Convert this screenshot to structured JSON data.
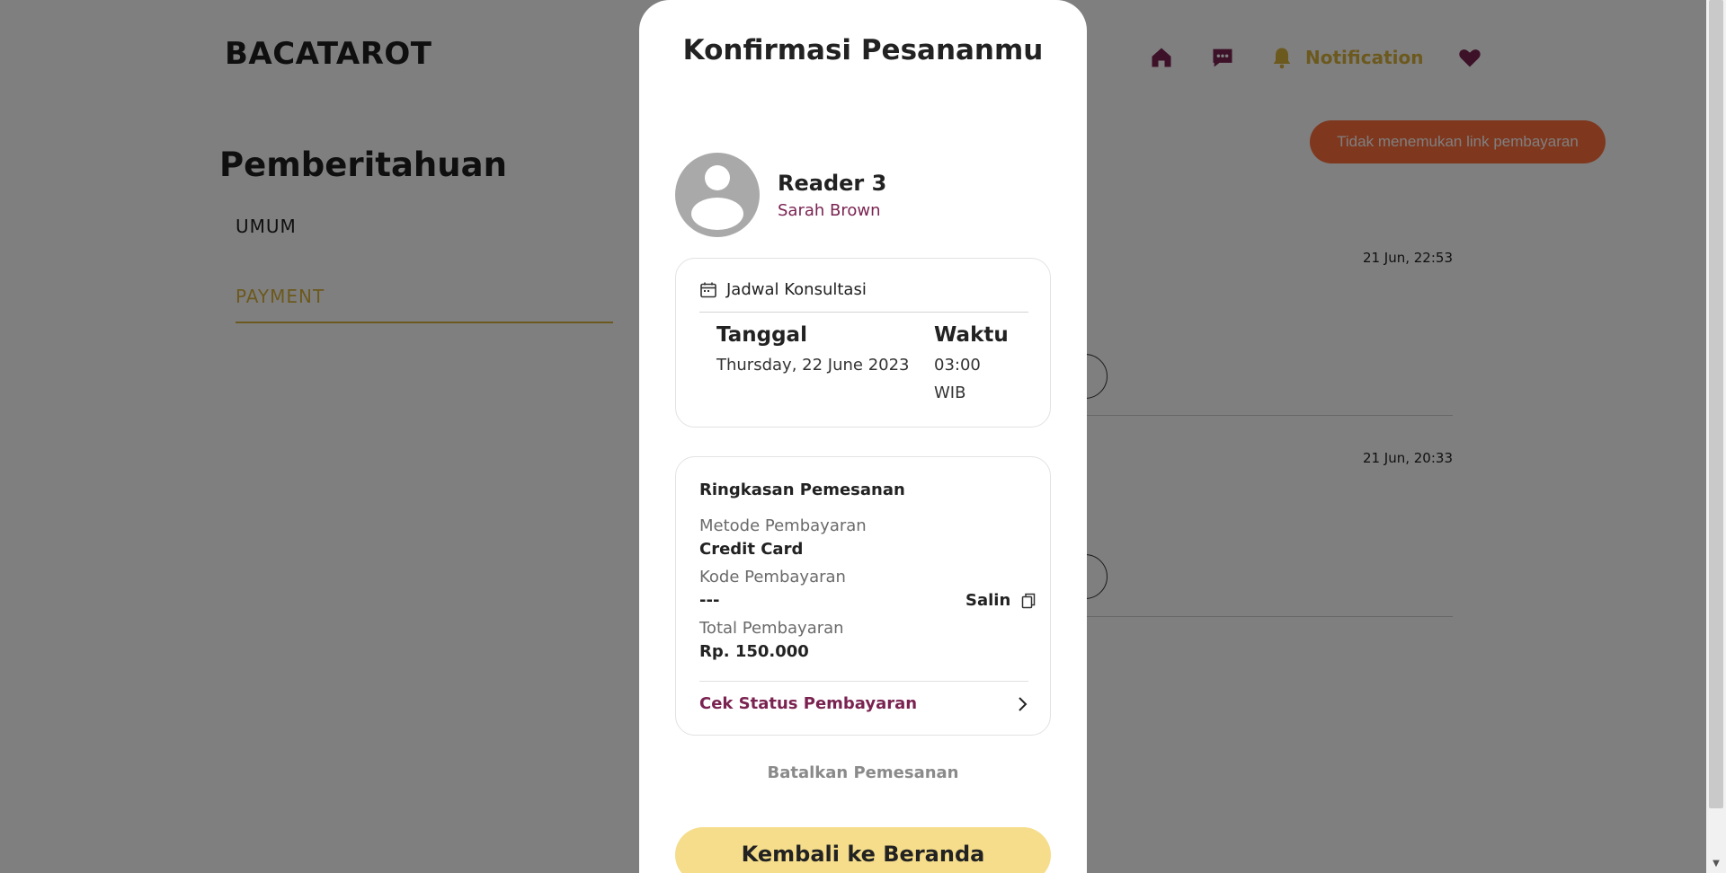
{
  "header": {
    "brand": "BACATAROT",
    "nav": {
      "home_icon": "home-icon",
      "chat_icon": "chat-icon",
      "notification_icon": "bell-icon",
      "notification_label": "Notification",
      "favorite_icon": "heart-icon"
    }
  },
  "page": {
    "title": "Pemberitahuan",
    "tabs": [
      {
        "label": "UMUM",
        "active": false
      },
      {
        "label": "PAYMENT",
        "active": true
      }
    ],
    "notifications": [
      {
        "time": "21 Jun, 22:53"
      },
      {
        "time": "21 Jun, 20:33"
      }
    ],
    "alert_button": "Tidak menemukan link pembayaran"
  },
  "modal": {
    "title": "Konfirmasi Pesananmu",
    "reader": {
      "name": "Reader 3",
      "subtitle": "Sarah Brown",
      "avatar_icon": "user-avatar-icon"
    },
    "schedule": {
      "heading": "Jadwal Konsultasi",
      "icon": "calendar-icon",
      "date_label": "Tanggal",
      "date_value": "Thursday, 22 June 2023",
      "time_label": "Waktu",
      "time_value": "03:00 WIB"
    },
    "summary": {
      "heading": "Ringkasan Pemesanan",
      "payment_method_label": "Metode Pembayaran",
      "payment_method_value": "Credit Card",
      "payment_code_label": "Kode Pembayaran",
      "payment_code_value": "---",
      "copy_label": "Salin",
      "copy_icon": "copy-icon",
      "total_label": "Total Pembayaran",
      "total_value": "Rp. 150.000",
      "status_link": "Cek Status Pembayaran",
      "status_icon": "chevron-right-icon"
    },
    "cancel_label": "Batalkan Pemesanan",
    "primary_button": "Kembali ke Beranda"
  },
  "colors": {
    "brand_gold": "#d8b33c",
    "brand_plum": "#7a2351",
    "alert_orange": "#ff6f3c",
    "primary_button": "#f5dd8b"
  }
}
